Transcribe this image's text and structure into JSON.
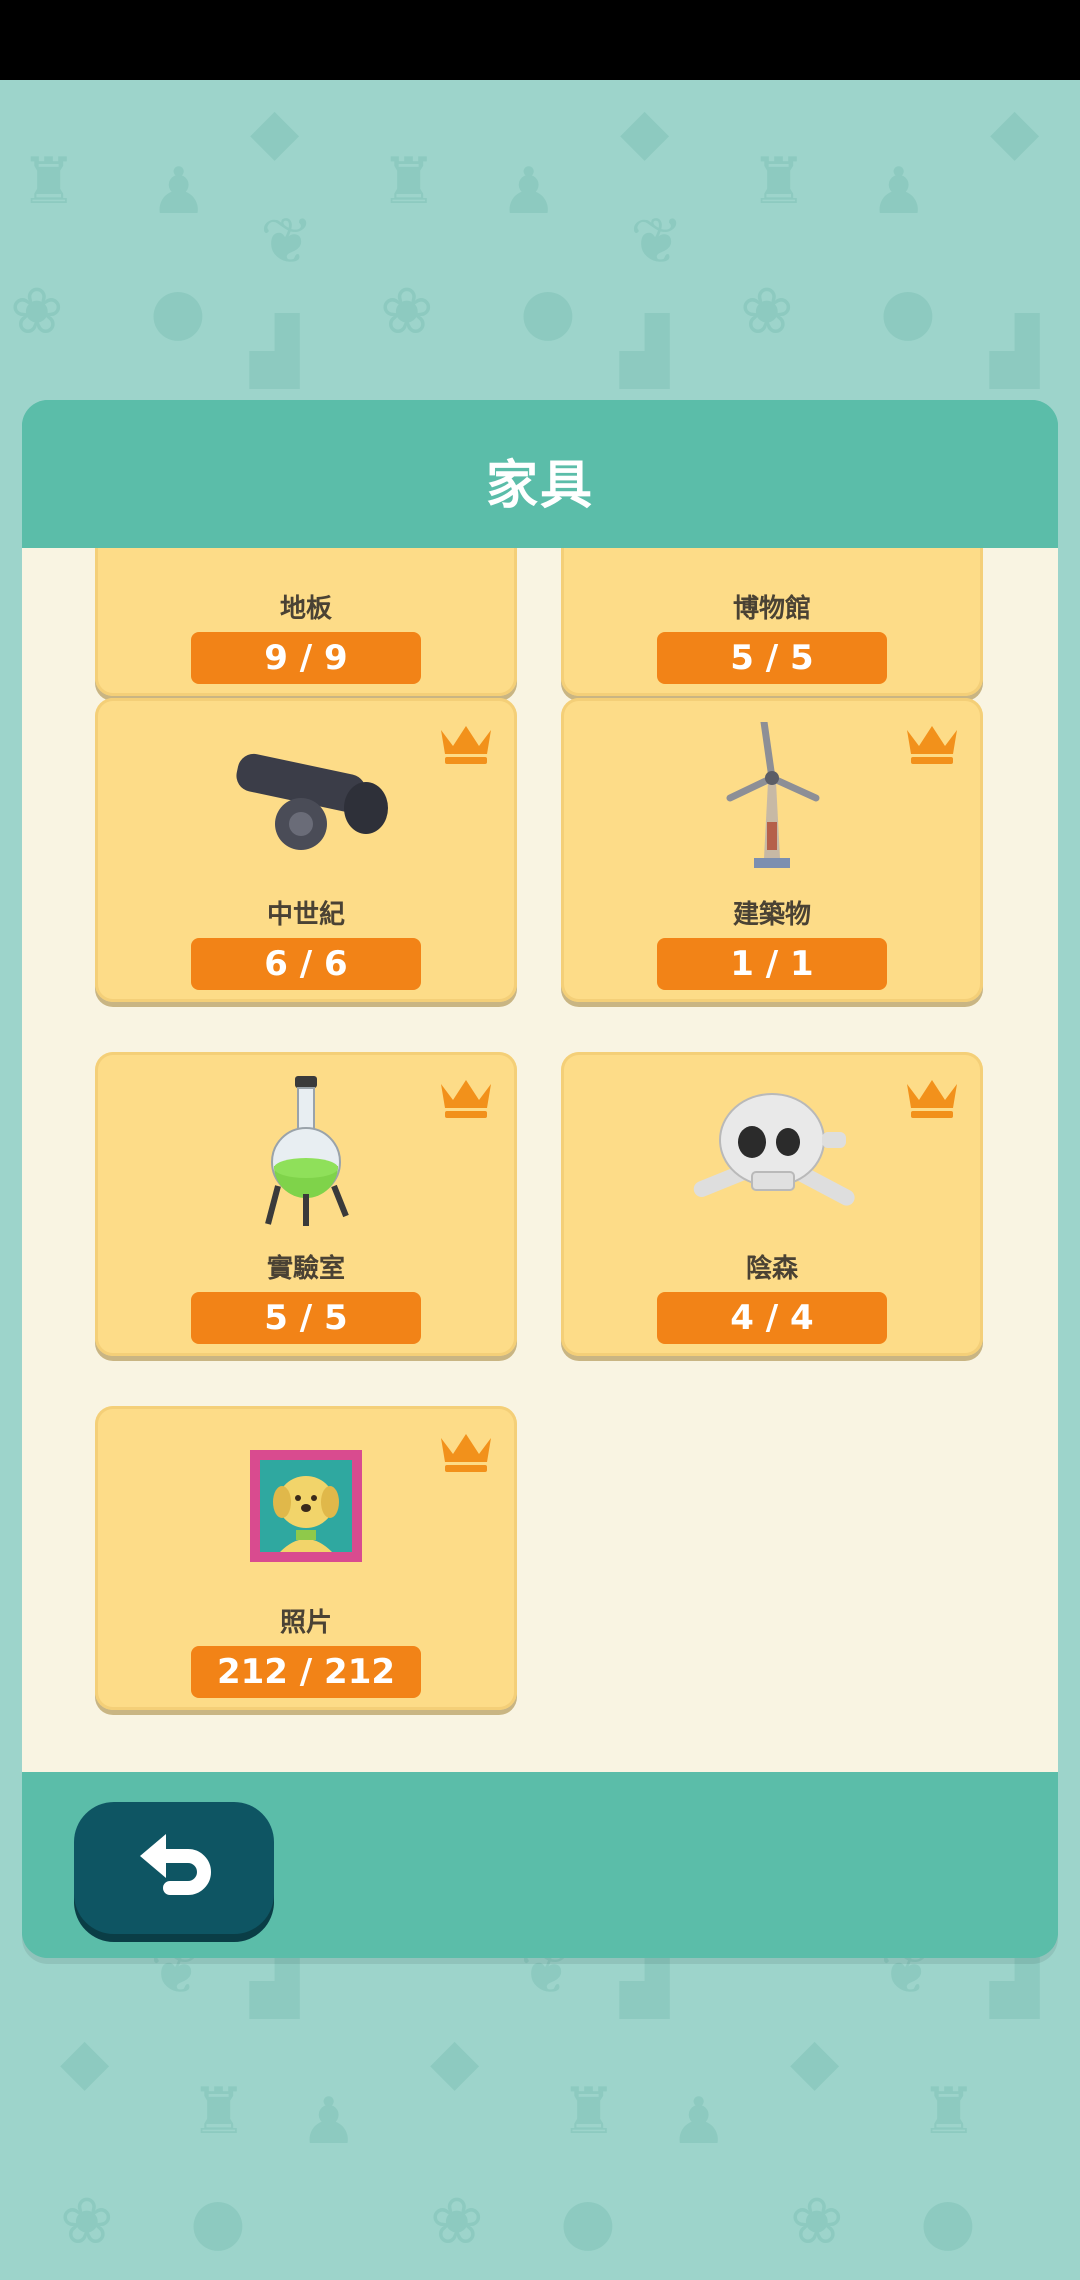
{
  "panel": {
    "title": "家具"
  },
  "cards": [
    {
      "label": "地板",
      "count": "9 / 9",
      "icon": "floor-icon",
      "crown": false
    },
    {
      "label": "博物館",
      "count": "5 / 5",
      "icon": "museum-icon",
      "crown": false
    },
    {
      "label": "中世紀",
      "count": "6 / 6",
      "icon": "cannon-icon",
      "crown": true
    },
    {
      "label": "建築物",
      "count": "1 / 1",
      "icon": "windmill-icon",
      "crown": true
    },
    {
      "label": "實驗室",
      "count": "5 / 5",
      "icon": "flask-icon",
      "crown": true
    },
    {
      "label": "陰森",
      "count": "4 / 4",
      "icon": "skull-icon",
      "crown": true
    },
    {
      "label": "照片",
      "count": "212 / 212",
      "icon": "photo-icon",
      "crown": true
    }
  ],
  "footer": {
    "back_icon": "undo-arrow-icon"
  },
  "colors": {
    "background": "#9dd4cb",
    "panel": "#5bbda9",
    "body": "#f9f4e2",
    "card": "#fddc88",
    "count_badge": "#f28317",
    "crown": "#f2911b",
    "back_button": "#0e5563"
  }
}
